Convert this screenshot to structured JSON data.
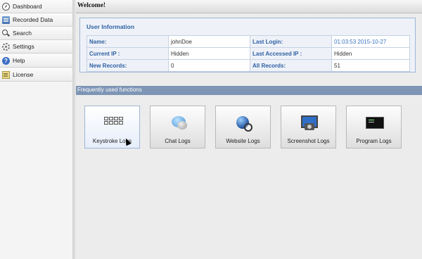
{
  "sidebar": {
    "items": [
      {
        "label": "Dashboard",
        "icon": "dashboard-icon"
      },
      {
        "label": "Recorded Data",
        "icon": "recorded-data-icon"
      },
      {
        "label": "Search",
        "icon": "search-icon"
      },
      {
        "label": "Settings",
        "icon": "gear-icon"
      },
      {
        "label": "Help",
        "icon": "help-icon"
      },
      {
        "label": "License",
        "icon": "license-icon"
      }
    ]
  },
  "header": {
    "title": "Welcome!"
  },
  "user_info": {
    "title": "User Information",
    "rows": [
      {
        "k1": "Name:",
        "v1": "johnDoe",
        "k2": "Last Login:",
        "v2": "01:03:53 2015-10-27"
      },
      {
        "k1": "Current IP :",
        "v1": "Hidden",
        "k2": "Last Accessed IP :",
        "v2": "Hidden"
      },
      {
        "k1": "New Records:",
        "v1": "0",
        "k2": "All Records:",
        "v2": "51"
      }
    ]
  },
  "functions": {
    "title": "Frequently used functions",
    "tiles": [
      {
        "label": "Keystroke Logs",
        "icon": "keyboard-icon"
      },
      {
        "label": "Chat Logs",
        "icon": "chat-bubbles-icon"
      },
      {
        "label": "Website Logs",
        "icon": "globe-icon"
      },
      {
        "label": "Screenshot Logs",
        "icon": "screenshot-icon"
      },
      {
        "label": "Program Logs",
        "icon": "terminal-icon"
      }
    ]
  },
  "colors": {
    "accent_blue": "#2e5fa3",
    "section_bar": "#7e95b5",
    "panel_bg": "#eef2f8"
  }
}
